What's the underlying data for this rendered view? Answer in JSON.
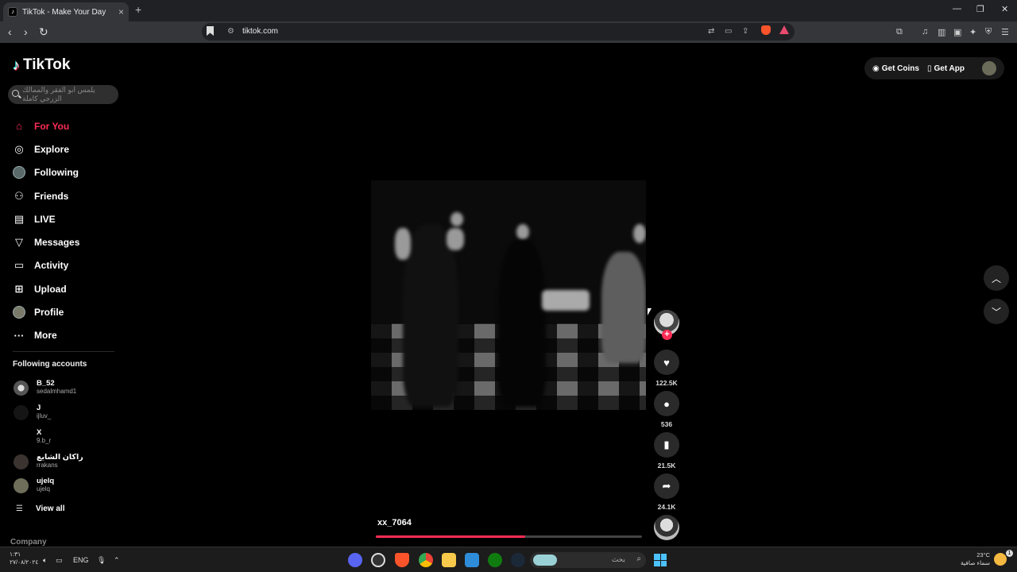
{
  "browser": {
    "tab_title": "TikTok - Make Your Day",
    "tab_close": "×",
    "new_tab": "+",
    "url": "tiktok.com",
    "window_controls": [
      "—",
      "❐",
      "✕"
    ]
  },
  "tiktok": {
    "logo_text": "TikTok",
    "search_placeholder": "يلمس ابو الفقر والممالك الزرجي كاملة",
    "nav": [
      {
        "label": "For You",
        "icon": "home-icon",
        "active": true
      },
      {
        "label": "Explore",
        "icon": "compass-icon"
      },
      {
        "label": "Following",
        "icon": "following-avatar-icon"
      },
      {
        "label": "Friends",
        "icon": "friends-icon"
      },
      {
        "label": "LIVE",
        "icon": "live-icon"
      },
      {
        "label": "Messages",
        "icon": "messages-icon"
      },
      {
        "label": "Activity",
        "icon": "activity-icon"
      },
      {
        "label": "Upload",
        "icon": "upload-icon"
      },
      {
        "label": "Profile",
        "icon": "profile-avatar-icon"
      },
      {
        "label": "More",
        "icon": "more-icon"
      }
    ],
    "following_title": "Following accounts",
    "accounts": [
      {
        "name": "B_52",
        "handle": "sedalmhamd1"
      },
      {
        "name": "J",
        "handle": "ijluv_"
      },
      {
        "name": "X",
        "handle": "9.b_r"
      },
      {
        "name": "راكان الشايع",
        "handle": "rrakans"
      },
      {
        "name": "ujelq",
        "handle": "ujelq"
      }
    ],
    "view_all": "View all",
    "company": "Company",
    "get_coins": "Get Coins",
    "get_app": "Get App",
    "video": {
      "author": "xx_7064",
      "progress": 0.56,
      "likes": "122.5K",
      "comments": "536",
      "saves": "21.5K",
      "shares": "24.1K"
    }
  },
  "taskbar": {
    "time": "١:٣١",
    "date": "٢٧/٠٨/٢٠٢٤",
    "lang": "ENG",
    "search_label": "بحث",
    "temp": "23°C",
    "weather": "سماء صافية",
    "notif_count": "1"
  },
  "colors": {
    "accent": "#fe2c55",
    "bg": "#000000",
    "chrome_dark": "#202124",
    "chrome_mid": "#35363a"
  }
}
